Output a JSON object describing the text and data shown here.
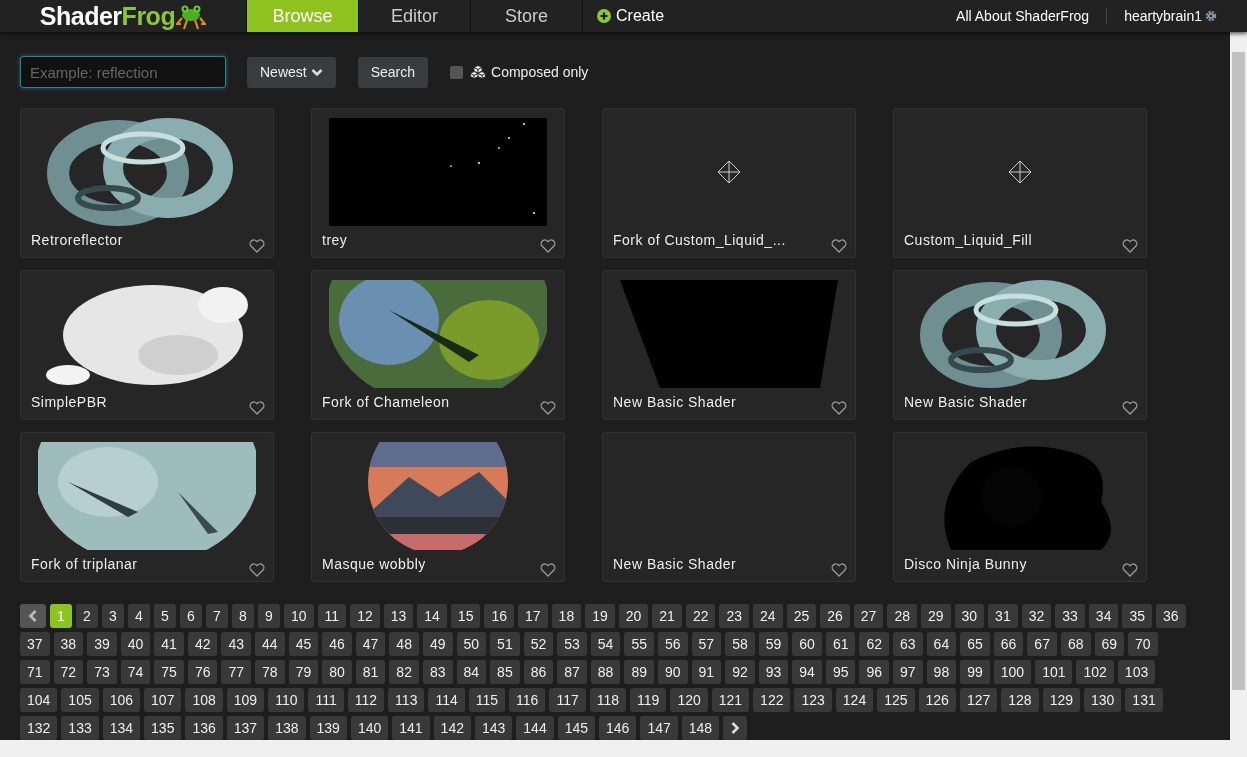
{
  "header": {
    "logo": {
      "part_1": "Shader",
      "part_2": "Frog"
    },
    "nav": [
      {
        "label": "Browse",
        "selected": true,
        "kind": "tab"
      },
      {
        "label": "Editor",
        "selected": false,
        "kind": "tab"
      },
      {
        "label": "Store",
        "selected": false,
        "kind": "tab"
      },
      {
        "label": "Create",
        "selected": false,
        "kind": "create"
      }
    ],
    "links": [
      "All About ShaderFrog"
    ],
    "user": "heartybrain1"
  },
  "search": {
    "placeholder": "Example: reflection",
    "sort": "Newest",
    "button": "Search",
    "composed_only": {
      "label": "Composed only",
      "checked": false
    }
  },
  "shaders": [
    {
      "title": "Retroreflector",
      "kind": "picture"
    },
    {
      "title": "trey",
      "kind": "picture"
    },
    {
      "title": "Fork of Custom_Liquid_...",
      "kind": "placeholder"
    },
    {
      "title": "Custom_Liquid_Fill",
      "kind": "placeholder"
    },
    {
      "title": "SimplePBR",
      "kind": "picture"
    },
    {
      "title": "Fork of Chameleon",
      "kind": "picture"
    },
    {
      "title": "New Basic Shader",
      "kind": "picture"
    },
    {
      "title": "New Basic Shader",
      "kind": "picture"
    },
    {
      "title": "Fork of triplanar",
      "kind": "picture"
    },
    {
      "title": "Masque wobbly",
      "kind": "picture"
    },
    {
      "title": "New Basic Shader",
      "kind": "empty"
    },
    {
      "title": "Disco Ninja Bunny",
      "kind": "picture"
    }
  ],
  "pagination": {
    "pages": [
      {
        "label": "1",
        "selected": true
      },
      {
        "label": "2",
        "selected": false
      },
      {
        "label": "3",
        "selected": false
      },
      {
        "label": "4",
        "selected": false
      },
      {
        "label": "5",
        "selected": false
      },
      {
        "label": "6",
        "selected": false
      },
      {
        "label": "7",
        "selected": false
      },
      {
        "label": "8",
        "selected": false
      },
      {
        "label": "9",
        "selected": false
      },
      {
        "label": "10",
        "selected": false
      },
      {
        "label": "11",
        "selected": false
      },
      {
        "label": "12",
        "selected": false
      },
      {
        "label": "13",
        "selected": false
      },
      {
        "label": "14",
        "selected": false
      },
      {
        "label": "15",
        "selected": false
      },
      {
        "label": "16",
        "selected": false
      },
      {
        "label": "17",
        "selected": false
      },
      {
        "label": "18",
        "selected": false
      },
      {
        "label": "19",
        "selected": false
      },
      {
        "label": "20",
        "selected": false
      },
      {
        "label": "21",
        "selected": false
      },
      {
        "label": "22",
        "selected": false
      },
      {
        "label": "23",
        "selected": false
      },
      {
        "label": "24",
        "selected": false
      },
      {
        "label": "25",
        "selected": false
      },
      {
        "label": "26",
        "selected": false
      },
      {
        "label": "27",
        "selected": false
      },
      {
        "label": "28",
        "selected": false
      },
      {
        "label": "29",
        "selected": false
      },
      {
        "label": "30",
        "selected": false
      },
      {
        "label": "31",
        "selected": false
      },
      {
        "label": "32",
        "selected": false
      },
      {
        "label": "33",
        "selected": false
      },
      {
        "label": "34",
        "selected": false
      },
      {
        "label": "35",
        "selected": false
      },
      {
        "label": "36",
        "selected": false
      },
      {
        "label": "37",
        "selected": false
      },
      {
        "label": "38",
        "selected": false
      },
      {
        "label": "39",
        "selected": false
      },
      {
        "label": "40",
        "selected": false
      },
      {
        "label": "41",
        "selected": false
      },
      {
        "label": "42",
        "selected": false
      },
      {
        "label": "43",
        "selected": false
      },
      {
        "label": "44",
        "selected": false
      },
      {
        "label": "45",
        "selected": false
      },
      {
        "label": "46",
        "selected": false
      },
      {
        "label": "47",
        "selected": false
      },
      {
        "label": "48",
        "selected": false
      },
      {
        "label": "49",
        "selected": false
      },
      {
        "label": "50",
        "selected": false
      },
      {
        "label": "51",
        "selected": false
      },
      {
        "label": "52",
        "selected": false
      },
      {
        "label": "53",
        "selected": false
      },
      {
        "label": "54",
        "selected": false
      },
      {
        "label": "55",
        "selected": false
      },
      {
        "label": "56",
        "selected": false
      },
      {
        "label": "57",
        "selected": false
      },
      {
        "label": "58",
        "selected": false
      },
      {
        "label": "59",
        "selected": false
      },
      {
        "label": "60",
        "selected": false
      },
      {
        "label": "61",
        "selected": false
      },
      {
        "label": "62",
        "selected": false
      },
      {
        "label": "63",
        "selected": false
      },
      {
        "label": "64",
        "selected": false
      },
      {
        "label": "65",
        "selected": false
      },
      {
        "label": "66",
        "selected": false
      },
      {
        "label": "67",
        "selected": false
      },
      {
        "label": "68",
        "selected": false
      },
      {
        "label": "69",
        "selected": false
      },
      {
        "label": "70",
        "selected": false
      },
      {
        "label": "71",
        "selected": false
      },
      {
        "label": "72",
        "selected": false
      },
      {
        "label": "73",
        "selected": false
      },
      {
        "label": "74",
        "selected": false
      },
      {
        "label": "75",
        "selected": false
      },
      {
        "label": "76",
        "selected": false
      },
      {
        "label": "77",
        "selected": false
      },
      {
        "label": "78",
        "selected": false
      },
      {
        "label": "79",
        "selected": false
      },
      {
        "label": "80",
        "selected": false
      },
      {
        "label": "81",
        "selected": false
      },
      {
        "label": "82",
        "selected": false
      },
      {
        "label": "83",
        "selected": false
      },
      {
        "label": "84",
        "selected": false
      },
      {
        "label": "85",
        "selected": false
      },
      {
        "label": "86",
        "selected": false
      },
      {
        "label": "87",
        "selected": false
      },
      {
        "label": "88",
        "selected": false
      },
      {
        "label": "89",
        "selected": false
      },
      {
        "label": "90",
        "selected": false
      },
      {
        "label": "91",
        "selected": false
      },
      {
        "label": "92",
        "selected": false
      },
      {
        "label": "93",
        "selected": false
      },
      {
        "label": "94",
        "selected": false
      },
      {
        "label": "95",
        "selected": false
      },
      {
        "label": "96",
        "selected": false
      },
      {
        "label": "97",
        "selected": false
      },
      {
        "label": "98",
        "selected": false
      },
      {
        "label": "99",
        "selected": false
      },
      {
        "label": "100",
        "selected": false
      },
      {
        "label": "101",
        "selected": false
      },
      {
        "label": "102",
        "selected": false
      },
      {
        "label": "103",
        "selected": false
      },
      {
        "label": "104",
        "selected": false
      },
      {
        "label": "105",
        "selected": false
      },
      {
        "label": "106",
        "selected": false
      },
      {
        "label": "107",
        "selected": false
      },
      {
        "label": "108",
        "selected": false
      },
      {
        "label": "109",
        "selected": false
      },
      {
        "label": "110",
        "selected": false
      },
      {
        "label": "111",
        "selected": false
      },
      {
        "label": "112",
        "selected": false
      },
      {
        "label": "113",
        "selected": false
      },
      {
        "label": "114",
        "selected": false
      },
      {
        "label": "115",
        "selected": false
      },
      {
        "label": "116",
        "selected": false
      },
      {
        "label": "117",
        "selected": false
      },
      {
        "label": "118",
        "selected": false
      },
      {
        "label": "119",
        "selected": false
      },
      {
        "label": "120",
        "selected": false
      },
      {
        "label": "121",
        "selected": false
      },
      {
        "label": "122",
        "selected": false
      },
      {
        "label": "123",
        "selected": false
      },
      {
        "label": "124",
        "selected": false
      },
      {
        "label": "125",
        "selected": false
      },
      {
        "label": "126",
        "selected": false
      },
      {
        "label": "127",
        "selected": false
      },
      {
        "label": "128",
        "selected": false
      },
      {
        "label": "129",
        "selected": false
      },
      {
        "label": "130",
        "selected": false
      },
      {
        "label": "131",
        "selected": false
      },
      {
        "label": "132",
        "selected": false
      },
      {
        "label": "133",
        "selected": false
      },
      {
        "label": "134",
        "selected": false
      },
      {
        "label": "135",
        "selected": false
      },
      {
        "label": "136",
        "selected": false
      },
      {
        "label": "137",
        "selected": false
      },
      {
        "label": "138",
        "selected": false
      },
      {
        "label": "139",
        "selected": false
      },
      {
        "label": "140",
        "selected": false
      },
      {
        "label": "141",
        "selected": false
      },
      {
        "label": "142",
        "selected": false
      },
      {
        "label": "143",
        "selected": false
      },
      {
        "label": "144",
        "selected": false
      },
      {
        "label": "145",
        "selected": false
      },
      {
        "label": "146",
        "selected": false
      },
      {
        "label": "147",
        "selected": false
      },
      {
        "label": "148",
        "selected": false
      }
    ]
  }
}
